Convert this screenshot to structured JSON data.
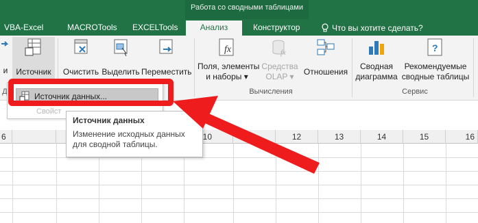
{
  "window": {
    "context_title": "Работа со сводными таблицами"
  },
  "tabs": [
    {
      "label": "VBA-Excel"
    },
    {
      "label": "MACROTools"
    },
    {
      "label": "EXCELTools"
    },
    {
      "label": "Анализ"
    },
    {
      "label": "Конструктор"
    },
    {
      "label": "Что вы хотите сделать?"
    }
  ],
  "ribbon": {
    "buttons": {
      "source": "Источник",
      "clear": "Очистить",
      "select": "Выделить",
      "move": "Переместить",
      "fields_line1": "Поля, элементы",
      "fields_line2": "и наборы ▾",
      "olap_line1": "Средства",
      "olap_line2": "OLAP ▾",
      "relations": "Отношения",
      "chart_line1": "Сводная",
      "chart_line2": "диаграмма",
      "recommended_line1": "Рекомендуемые",
      "recommended_line2": "сводные таблицы"
    },
    "groups": {
      "data_partial": "Да",
      "calculations": "Вычисления",
      "service": "Сервис"
    },
    "left_cut_label": "и"
  },
  "dropdown": {
    "item_source": "Источник данных...",
    "item_properties": "Свойст"
  },
  "tooltip": {
    "title": "Источник данных",
    "body": "Изменение исходных данных для сводной таблицы."
  },
  "sheet": {
    "columns": [
      "6",
      "",
      "",
      "",
      "",
      "10",
      "",
      "12",
      "13",
      "14",
      "15",
      "16"
    ]
  },
  "colors": {
    "excel_green": "#217346",
    "highlight_red": "#ee1c1c"
  }
}
